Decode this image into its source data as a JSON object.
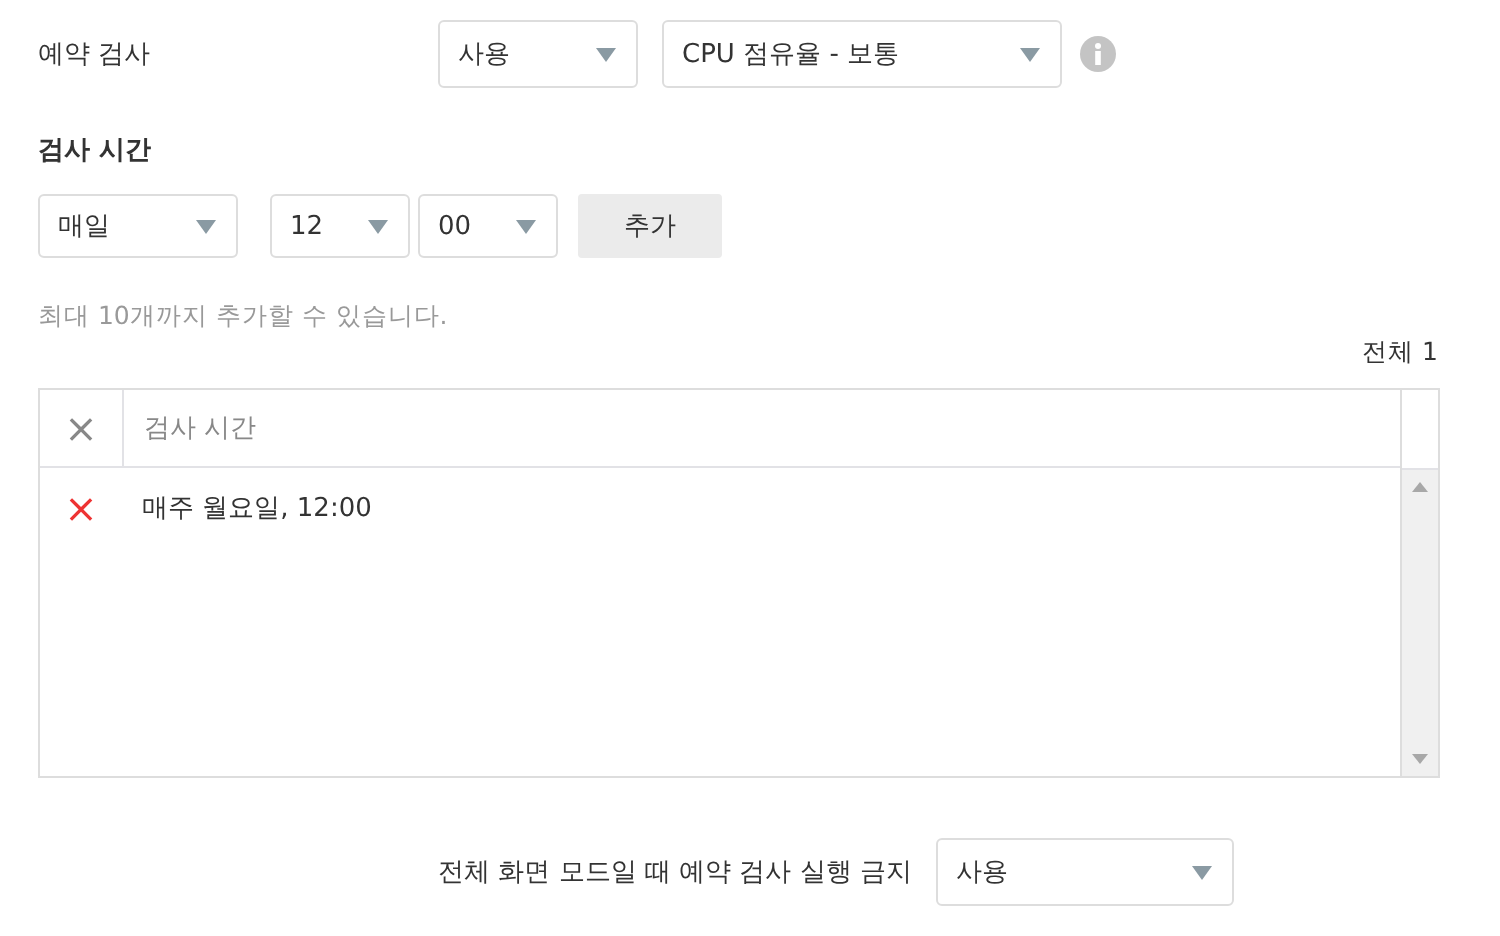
{
  "scheduled_scan": {
    "label": "예약 검사",
    "mode": "사용",
    "cpu": "CPU 점유율 - 보통"
  },
  "scan_time": {
    "heading": "검사 시간",
    "frequency": "매일",
    "hour": "12",
    "minute": "00",
    "add_button": "추가",
    "hint": "최대 10개까지 추가할 수 있습니다.",
    "total": "전체 1"
  },
  "table": {
    "columns": [
      "×",
      "검사 시간"
    ],
    "rows": [
      {
        "remove": "×",
        "time": "매주 월요일, 12:00"
      }
    ]
  },
  "fullscreen": {
    "label": "전체 화면 모드일 때 예약 검사 실행 금지",
    "value": "사용"
  }
}
